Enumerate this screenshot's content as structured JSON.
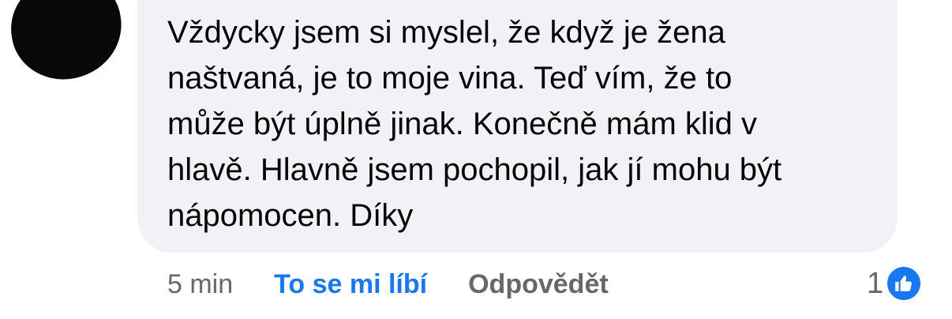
{
  "comment": {
    "text": "Vždycky jsem si myslel, že když je žena\nnaštvaná, je to moje vina. Teď vím, že to\nmůže být úplně jinak. Konečně mám klid v\nhlavě. Hlavně jsem pochopil, jak jí mohu být\nnápomocen. Díky",
    "timestamp": "5 min",
    "like_label": "To se mi líbí",
    "reply_label": "Odpovědět",
    "reaction_count": "1",
    "reaction_icon": "thumbs-up-icon"
  },
  "colors": {
    "bubble_background": "#f0f2f5",
    "accent_blue": "#1877f2",
    "secondary_text": "#65676b",
    "primary_text": "#050505"
  }
}
